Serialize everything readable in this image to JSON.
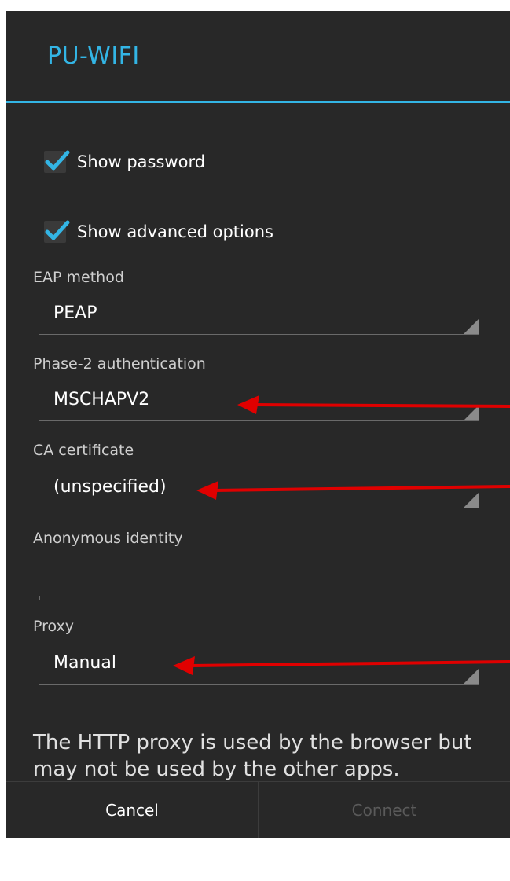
{
  "dialog": {
    "title": "PU-WIFI",
    "show_password": {
      "label": "Show password",
      "checked": true
    },
    "show_advanced": {
      "label": "Show advanced options",
      "checked": true
    },
    "fields": {
      "eap_method": {
        "label": "EAP method",
        "value": "PEAP"
      },
      "phase2": {
        "label": "Phase-2 authentication",
        "value": "MSCHAPV2"
      },
      "ca_cert": {
        "label": "CA certificate",
        "value": "(unspecified)"
      },
      "anonymous_identity": {
        "label": "Anonymous identity",
        "value": ""
      },
      "proxy": {
        "label": "Proxy",
        "value": "Manual"
      }
    },
    "proxy_note": "The HTTP proxy is used by the browser but may not be used by the other apps.",
    "buttons": {
      "cancel": "Cancel",
      "connect": "Connect"
    }
  },
  "colors": {
    "accent": "#33b5e5",
    "background": "#282828",
    "annotation_arrow": "#e00000"
  }
}
